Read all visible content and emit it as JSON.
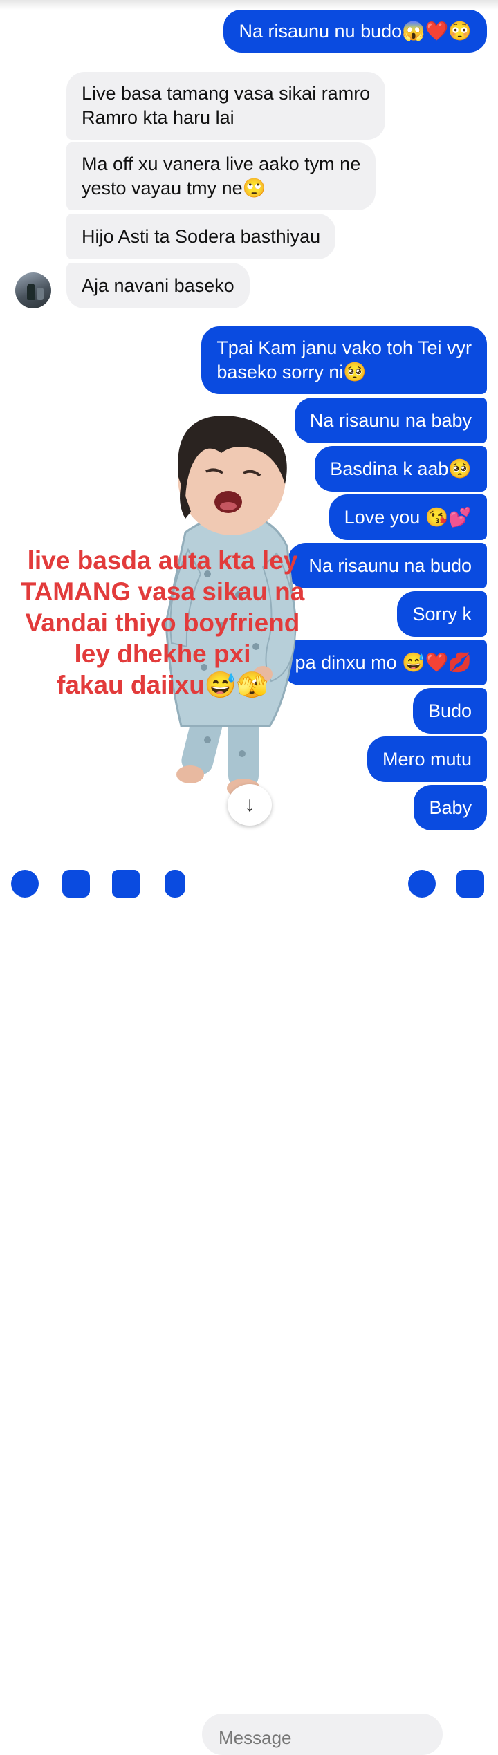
{
  "messages": [
    {
      "dir": "out",
      "text": "Na risaunu nu budo😱❤️😳"
    },
    {
      "dir": "in",
      "text": "Live basa tamang vasa sikai ramro\nRamro kta haru lai"
    },
    {
      "dir": "in",
      "text": "Ma off xu vanera live aako tym ne\nyesto vayau tmy ne🙄"
    },
    {
      "dir": "in",
      "text": "Hijo Asti ta Sodera basthiyau"
    },
    {
      "dir": "in",
      "text": "Aja navani baseko"
    },
    {
      "dir": "out",
      "text": "Tpai Kam janu vako toh Tei vyr\nbaseko sorry ni🥺"
    },
    {
      "dir": "out",
      "text": "Na risaunu na baby"
    },
    {
      "dir": "out",
      "text": "Basdina k aab🥺"
    },
    {
      "dir": "out",
      "text": "Love you 😘💕"
    },
    {
      "dir": "out",
      "text": "Na risaunu na budo"
    },
    {
      "dir": "out",
      "text": "Sorry k"
    },
    {
      "dir": "out",
      "text": "pa dinxu mo 😅❤️💋"
    },
    {
      "dir": "out",
      "text": "Budo"
    },
    {
      "dir": "out",
      "text": "Mero mutu"
    },
    {
      "dir": "out",
      "text": "Baby"
    }
  ],
  "overlay_caption": "live basda auta kta ley\nTAMANG vasa sikau na\nVandai thiyo  boyfriend\nley dhekhe pxi\nfakau daiixu😅🫣",
  "scroll_down_icon": "arrow-down-icon",
  "composer": {
    "placeholder": "Message",
    "icons": [
      "plus-icon",
      "camera-icon",
      "image-icon",
      "mic-icon",
      "emoji-icon",
      "thumbs-up-icon"
    ]
  },
  "colors": {
    "outgoing": "#0a4be0",
    "incoming": "#f0f0f2",
    "caption": "#e23b3b"
  }
}
